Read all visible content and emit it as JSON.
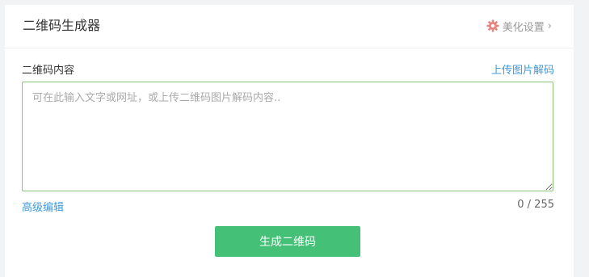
{
  "header": {
    "title": "二维码生成器",
    "beautify_label": "美化设置",
    "beautify_icon": "gear-icon",
    "chevron": "›"
  },
  "content": {
    "label": "二维码内容",
    "upload_link": "上传图片解码",
    "textarea_value": "",
    "textarea_placeholder": "可在此输入文字或网址，或上传二维码图片解码内容..",
    "advanced_edit": "高级编辑",
    "char_count": "0 / 255"
  },
  "actions": {
    "generate_label": "生成二维码"
  },
  "colors": {
    "accent_green": "#44c177",
    "link_blue": "#3e9ad8",
    "gear_red": "#e8837d",
    "textarea_border": "#8cc27a"
  }
}
